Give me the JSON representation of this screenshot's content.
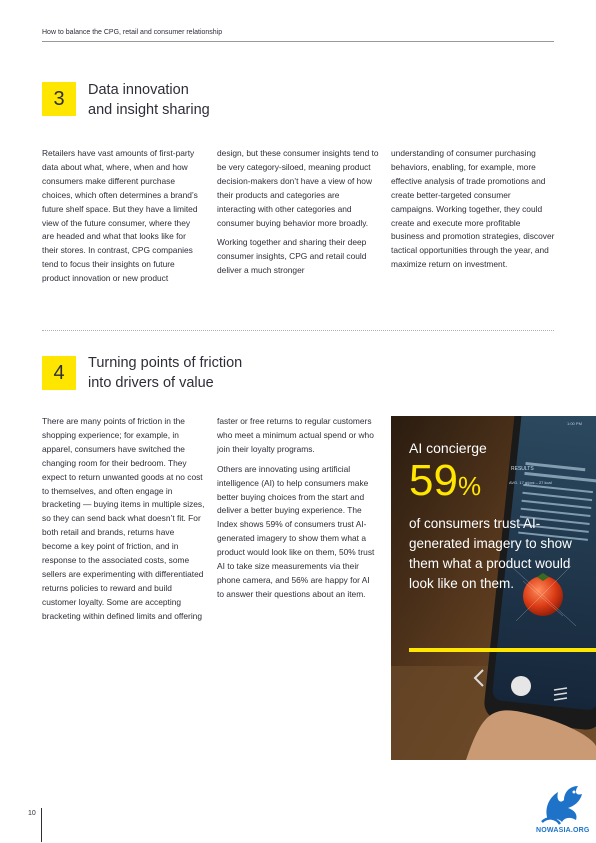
{
  "header": {
    "title": "How to balance the CPG, retail and consumer relationship"
  },
  "section3": {
    "number": "3",
    "title_line1": "Data innovation",
    "title_line2": "and insight sharing",
    "col1": "Retailers have vast amounts of first-party data about what, where, when and how consumers make different purchase choices, which often determines a brand’s future shelf space. But they have a limited view of the future consumer, where they are headed and what that looks like for their stores. In contrast, CPG companies tend to focus their insights on future product innovation or new product",
    "col2_p1": "design, but these consumer insights tend to be very category-siloed, meaning product decision-makers don’t have a view of how their products and categories are interacting with other categories and consumer buying behavior more broadly.",
    "col2_p2": "Working together and sharing their deep consumer insights, CPG and retail could deliver a much stronger",
    "col3": "understanding of consumer purchasing behaviors, enabling, for example, more effective analysis of trade promotions and create better-targeted consumer campaigns. Working together, they could create and execute more profitable business and promotion strategies, discover tactical opportunities through the year, and maximize return on investment."
  },
  "section4": {
    "number": "4",
    "title_line1": "Turning points of friction",
    "title_line2": "into drivers of value",
    "col1": "There are many points of friction in the shopping experience; for example, in apparel, consumers have switched the changing room for their bedroom. They expect to return unwanted goods at no cost to themselves, and often engage in bracketing — buying items in multiple sizes, so they can send back what doesn’t fit. For both retail and brands, returns have become a key point of friction, and in response to the associated costs, some sellers are experimenting with differentiated returns policies to reward and build customer loyalty. Some are accepting bracketing within defined limits and offering",
    "col2_p1": "faster or free returns to regular customers who meet a minimum actual spend or who join their loyalty programs.",
    "col2_p2": "Others are innovating using artificial intelligence (AI) to help consumers make better buying choices from the start and deliver a better buying experience. The Index shows 59% of consumers trust AI-generated imagery to show them what a product would look like on them, 50% trust AI to take size measurements via their phone camera, and 56% are happy for AI to answer their questions about an item."
  },
  "promo": {
    "label": "AI concierge",
    "stat": "59",
    "stat_unit": "%",
    "body": "of consumers trust AI-generated imagery to show them what a product would look like on them.",
    "phone_time": "1:00 PM",
    "phone_label": "RESULTS",
    "phone_value": "AVG. 17 g/pcs – 27 kcal"
  },
  "footer": {
    "page_number": "10",
    "watermark": "NOWASIA.ORG"
  },
  "colors": {
    "accent": "#ffe600",
    "text": "#2e2e38"
  }
}
